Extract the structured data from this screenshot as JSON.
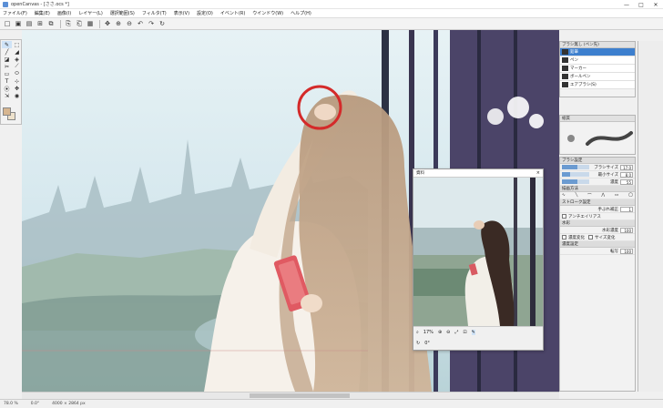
{
  "titlebar": {
    "title": "openCanvas - [ささ.ocs *]",
    "minimize": "—",
    "maximize": "□",
    "close": "✕"
  },
  "menu": [
    "ファイル(F)",
    "編集(E)",
    "画像(I)",
    "レイヤー(L)",
    "選択範囲(S)",
    "フィルタ(T)",
    "表示(V)",
    "設定(O)",
    "イベント(R)",
    "ウインドウ(W)",
    "ヘルプ(H)"
  ],
  "toolbar": {
    "group1": [
      "□",
      "▣",
      "▤",
      "⊞",
      "⧉"
    ],
    "group2": [
      "⎘",
      "⎗",
      "▦"
    ],
    "group3": [
      "✥",
      "⊕",
      "⊖",
      "↶",
      "↷",
      "↻"
    ]
  },
  "toolbox": [
    "✎",
    "⬚",
    "╱",
    "◢",
    "◪",
    "◈",
    "✂",
    "⟋",
    "▭",
    "⬭",
    "T",
    "⊹",
    "⦿",
    "✥",
    "⇲",
    "◉"
  ],
  "colors": {
    "accent": "#3d7fce",
    "highlight_circle": "#d42a2a",
    "phone": "#e05a62"
  },
  "brush_panel": {
    "title": "ブラシ無し (ペン先)",
    "items": [
      "鉛筆",
      "ペン",
      "マーカー",
      "ボールペン",
      "エアブラシ(S)"
    ],
    "selected": 0
  },
  "texture_panel": {
    "title": "紙質"
  },
  "props_panel": {
    "section_props": "ブラシ設定",
    "rows": [
      {
        "label": "ブラシサイズ",
        "value": "17.0",
        "fill": 0.55
      },
      {
        "label": "最小サイズ",
        "value": "8.0",
        "fill": 0.3
      },
      {
        "label": "濃度",
        "value": "55",
        "fill": 0.55
      }
    ],
    "section_draw": "描画方法",
    "section_stroke": "ストローク設定",
    "smooth_label": "手ぶれ補正",
    "smooth_value": "1",
    "antialias_label": "アンチエイリアス",
    "section_water": "水彩",
    "water_label": "水彩濃度",
    "water_value": "100",
    "pressure_density": "濃度変化",
    "pressure_size": "サイズ変化",
    "section_density": "濃度設定",
    "density_label": "転写",
    "density_value": "100"
  },
  "reference_window": {
    "title": "資料",
    "close": "×",
    "zoom": "17%",
    "rotate": "0°"
  },
  "statusbar": {
    "zoom": "78.0 %",
    "angle": "0.0°",
    "size": "4000 × 2864 px"
  }
}
